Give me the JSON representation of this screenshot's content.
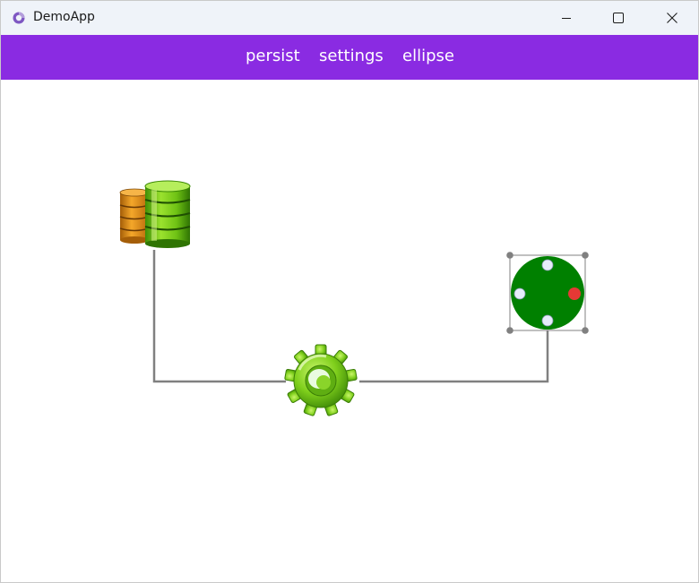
{
  "window": {
    "title": "DemoApp",
    "controls": [
      "minimize",
      "maximize",
      "close"
    ]
  },
  "menu": {
    "items": [
      {
        "label": "persist"
      },
      {
        "label": "settings"
      },
      {
        "label": "ellipse"
      }
    ]
  },
  "diagram": {
    "nodes": [
      {
        "id": "database",
        "icon": "database-icon"
      },
      {
        "id": "gear",
        "icon": "gear-icon"
      },
      {
        "id": "ellipse",
        "icon": "green-circle-node",
        "selected": true
      }
    ],
    "links": [
      {
        "from": "database",
        "to": "gear"
      },
      {
        "from": "gear",
        "to": "ellipse"
      }
    ]
  },
  "colors": {
    "menubar": "#8a2be2",
    "titlebar": "#eff3f9",
    "link": "#808080",
    "ellipse_fill": "#008000",
    "port": "#e6ecfa",
    "port_active": "#e53935"
  }
}
